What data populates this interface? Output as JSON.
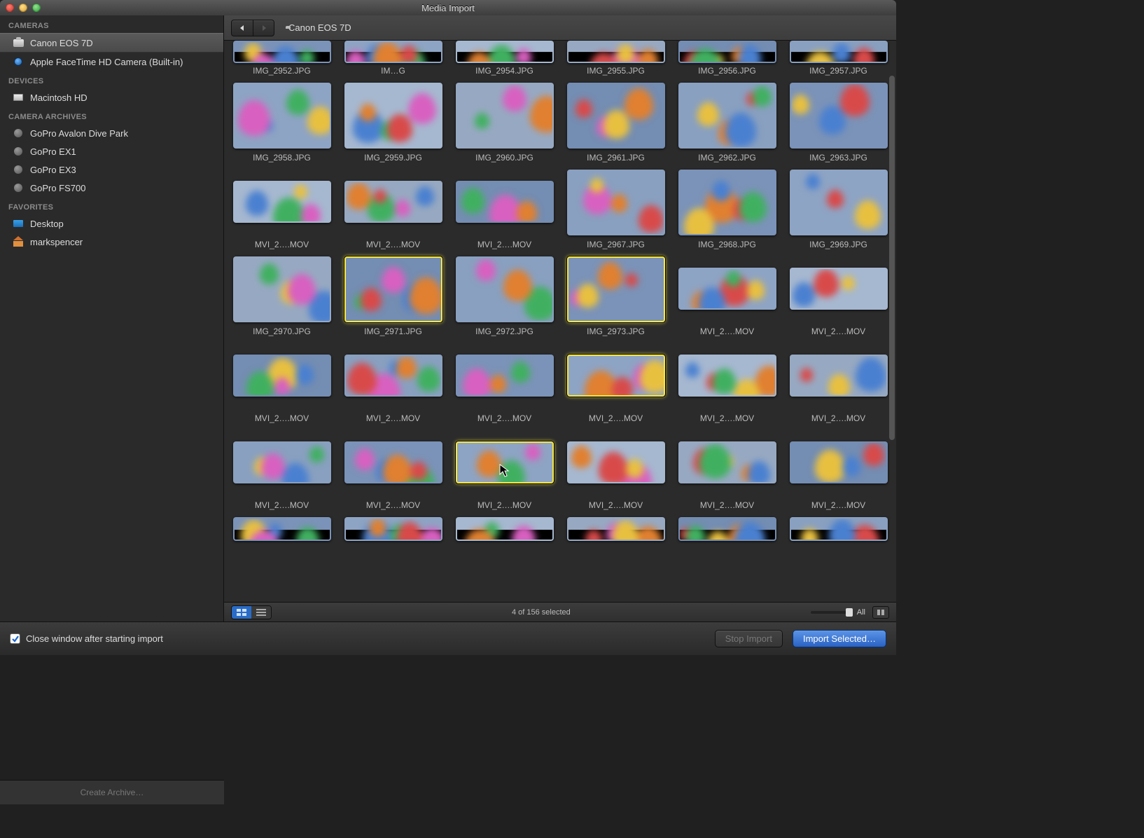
{
  "window": {
    "title": "Media Import"
  },
  "sidebar": {
    "sections": [
      {
        "header": "CAMERAS",
        "items": [
          {
            "icon": "camera",
            "label": "Canon EOS 7D",
            "selected": true
          },
          {
            "icon": "isight",
            "label": "Apple FaceTime HD Camera (Built-in)"
          }
        ]
      },
      {
        "header": "DEVICES",
        "items": [
          {
            "icon": "hd",
            "label": "Macintosh HD"
          }
        ]
      },
      {
        "header": "CAMERA ARCHIVES",
        "items": [
          {
            "icon": "archive",
            "label": "GoPro Avalon Dive Park"
          },
          {
            "icon": "archive",
            "label": "GoPro EX1"
          },
          {
            "icon": "archive",
            "label": "GoPro EX3"
          },
          {
            "icon": "archive",
            "label": "GoPro FS700"
          }
        ]
      },
      {
        "header": "FAVORITES",
        "items": [
          {
            "icon": "desktop",
            "label": "Desktop"
          },
          {
            "icon": "home",
            "label": "markspencer"
          }
        ]
      }
    ],
    "create_archive": "Create Archive…"
  },
  "breadcrumb": {
    "label": "Canon EOS 7D"
  },
  "grid": {
    "rows": [
      [
        {
          "n": "IMG_2952.JPG"
        },
        {
          "n": "IM…G"
        },
        {
          "n": "IMG_2954.JPG"
        },
        {
          "n": "IMG_2955.JPG"
        },
        {
          "n": "IMG_2956.JPG"
        },
        {
          "n": "IMG_2957.JPG"
        }
      ],
      [
        {
          "n": "IMG_2958.JPG"
        },
        {
          "n": "IMG_2959.JPG"
        },
        {
          "n": "IMG_2960.JPG"
        },
        {
          "n": "IMG_2961.JPG"
        },
        {
          "n": "IMG_2962.JPG"
        },
        {
          "n": "IMG_2963.JPG"
        }
      ],
      [
        {
          "n": "MVI_2….MOV",
          "v": true
        },
        {
          "n": "MVI_2….MOV",
          "v": true
        },
        {
          "n": "MVI_2….MOV",
          "v": true
        },
        {
          "n": "IMG_2967.JPG"
        },
        {
          "n": "IMG_2968.JPG"
        },
        {
          "n": "IMG_2969.JPG"
        }
      ],
      [
        {
          "n": "IMG_2970.JPG"
        },
        {
          "n": "IMG_2971.JPG",
          "s": true
        },
        {
          "n": "IMG_2972.JPG"
        },
        {
          "n": "IMG_2973.JPG",
          "s": true
        },
        {
          "n": "MVI_2….MOV",
          "v": true
        },
        {
          "n": "MVI_2….MOV",
          "v": true
        }
      ],
      [
        {
          "n": "MVI_2….MOV",
          "v": true
        },
        {
          "n": "MVI_2….MOV",
          "v": true
        },
        {
          "n": "MVI_2….MOV",
          "v": true
        },
        {
          "n": "MVI_2….MOV",
          "v": true,
          "s": true
        },
        {
          "n": "MVI_2….MOV",
          "v": true
        },
        {
          "n": "MVI_2….MOV",
          "v": true
        }
      ],
      [
        {
          "n": "MVI_2….MOV",
          "v": true
        },
        {
          "n": "MVI_2….MOV",
          "v": true
        },
        {
          "n": "MVI_2….MOV",
          "v": true,
          "s": true,
          "cursor": true
        },
        {
          "n": "MVI_2….MOV",
          "v": true
        },
        {
          "n": "MVI_2….MOV",
          "v": true
        },
        {
          "n": "MVI_2….MOV",
          "v": true
        }
      ],
      [
        {
          "n": "",
          "p": true
        },
        {
          "n": "",
          "p": true
        },
        {
          "n": "",
          "p": true
        },
        {
          "n": "",
          "p": true
        },
        {
          "n": "",
          "p": true
        },
        {
          "n": "",
          "p": true
        }
      ]
    ]
  },
  "footer": {
    "status": "4 of 156 selected",
    "slider_label": "All"
  },
  "bottom": {
    "checkbox_label": "Close window after starting import",
    "checkbox_checked": true,
    "stop_label": "Stop Import",
    "import_label": "Import Selected…"
  }
}
